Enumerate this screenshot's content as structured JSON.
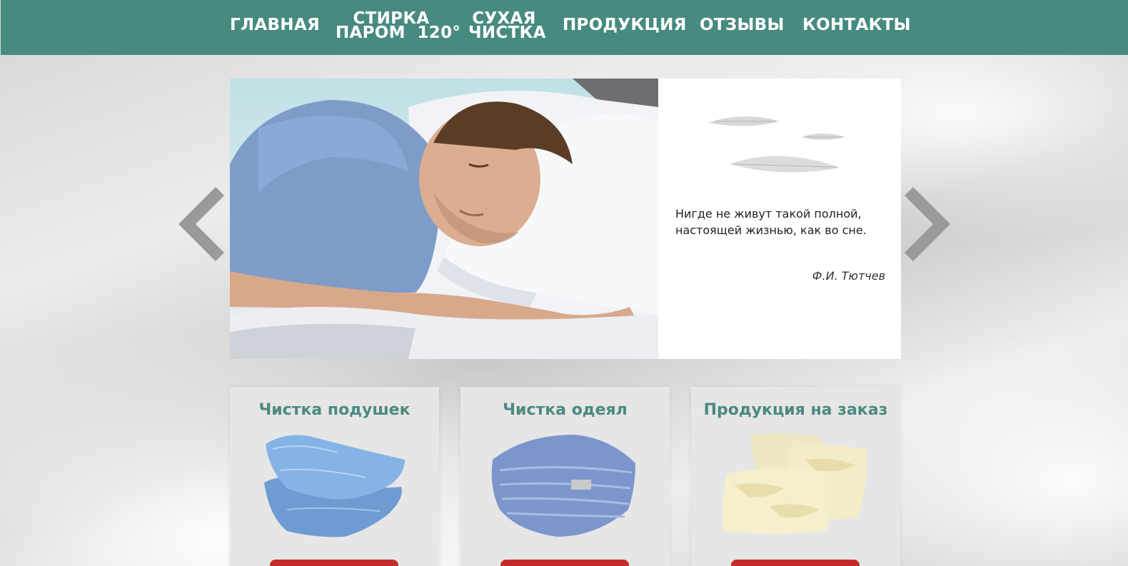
{
  "nav": {
    "items": [
      {
        "lines": [
          "ГЛАВНАЯ"
        ]
      },
      {
        "lines": [
          "СТИРКА",
          "ПАРОМ  120°"
        ]
      },
      {
        "lines": [
          "СУХАЯ",
          "ЧИСТКА"
        ]
      },
      {
        "lines": [
          "ПРОДУКЦИЯ"
        ]
      },
      {
        "lines": [
          "ОТЗЫВЫ"
        ]
      },
      {
        "lines": [
          "КОНТАКТЫ"
        ]
      }
    ]
  },
  "slider": {
    "quote_line1": "Нигде не живут такой полной,",
    "quote_line2": "настоящей жизнью, как во сне.",
    "author": "Ф.И. Тютчев"
  },
  "cards": [
    {
      "title": "Чистка подушек"
    },
    {
      "title": "Чистка одеял"
    },
    {
      "title": "Продукция на заказ"
    }
  ],
  "colors": {
    "header": "#478a80",
    "card_title": "#4a8a80",
    "button": "#c52b2b",
    "arrow": "#9a9a9a"
  }
}
